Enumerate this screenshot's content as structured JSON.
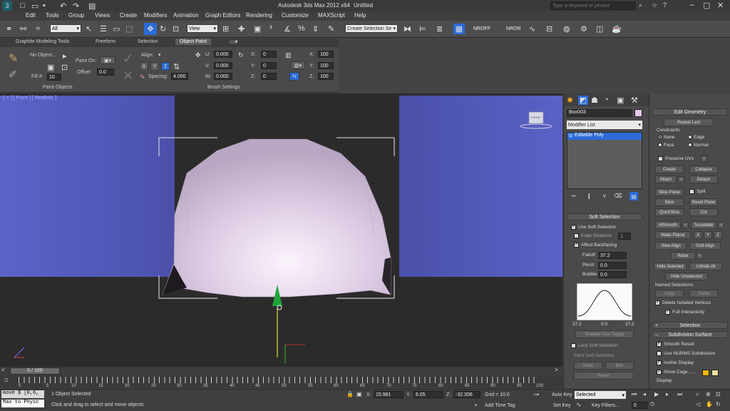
{
  "window": {
    "title": "Autodesk 3ds Max  2012 x64",
    "doc": "Untitled",
    "search_placeholder": "Type a keyword or phrase"
  },
  "menu": [
    "Edit",
    "Tools",
    "Group",
    "Views",
    "Create",
    "Modifiers",
    "Animation",
    "Graph Editors",
    "Rendering",
    "Customize",
    "MAXScript",
    "Help"
  ],
  "toolbar": {
    "filter": "All",
    "refcoord": "View",
    "selection_set": "Create Selection Se",
    "nroff": "NROFF",
    "nron": "NRON"
  },
  "ribbon": {
    "tabs": [
      "Graphite Modeling Tools",
      "Freeform",
      "Selection",
      "Object Paint"
    ],
    "no_object": "No Object...",
    "paint_on": "Paint On:",
    "fill_label": "Fill #:",
    "fill_value": "10",
    "offset_label": "Offset:",
    "offset_value": "0.0",
    "align_label": "Align:",
    "spacing_label": "Spacing:",
    "spacing_value": "4.000",
    "u": "0.000",
    "v": "0.000",
    "w": "0.000",
    "rx": "0",
    "ry": "0",
    "rz": "0",
    "sx": "100",
    "sy": "100",
    "sz": "100",
    "group1": "Paint Objects",
    "group2": "Brush Settings"
  },
  "viewport": {
    "label": "[ + ] [ Front ] [ Realistic ]",
    "viewcube": "FRONT"
  },
  "command_panel": {
    "object_name": "Box003",
    "modifier_list": "Modifier List",
    "stack_item": "Editable Poly",
    "soft_selection": {
      "title": "Soft Selection",
      "use_soft": "Use Soft Selection",
      "edge_distance": "Edge Distance:",
      "edge_val": "1",
      "affect_backfacing": "Affect Backfacing",
      "falloff": "Falloff:",
      "falloff_val": "37.2",
      "pinch": "Pinch:",
      "pinch_val": "0.0",
      "bubble": "Bubble:",
      "bubble_val": "0.0",
      "curve_labels": [
        "37.2",
        "0.0",
        "37.2"
      ],
      "shaded_face": "Shaded Face Toggle",
      "lock": "Lock Soft Selection",
      "paint_soft": "Paint Soft Selection",
      "paint": "Paint",
      "blur": "Blur",
      "revert": "Revert"
    }
  },
  "rollout": {
    "edit_geometry": "Edit Geometry",
    "repeat_last": "Repeat Last",
    "constraints": "Constraints",
    "none": "None",
    "edge": "Edge",
    "face": "Face",
    "normal": "Normal",
    "preserve_uvs": "Preserve UVs",
    "create": "Create",
    "collapse": "Collapse",
    "attach": "Attach",
    "detach": "Detach",
    "slice_plane": "Slice Plane",
    "split": "Split",
    "slice": "Slice",
    "reset_plane": "Reset Plane",
    "quickslice": "QuickSlice",
    "cut": "Cut",
    "msmooth": "MSmooth",
    "tessellate": "Tessellate",
    "make_planar": "Make Planar",
    "x": "X",
    "y": "Y",
    "z": "Z",
    "view_align": "View Align",
    "grid_align": "Grid Align",
    "relax": "Relax",
    "hide_selected": "Hide Selected",
    "unhide_all": "Unhide All",
    "hide_unselected": "Hide Unselected",
    "named_selections": "Named Selections:",
    "copy": "Copy",
    "paste": "Paste",
    "delete_isolated": "Delete Isolated Vertices",
    "full_interactivity": "Full Interactivity",
    "selection": "Selection",
    "subdivision_surface": "Subdivision Surface",
    "smooth_result": "Smooth Result",
    "use_nurms": "Use NURMS Subdivision",
    "isoline": "Isoline Display",
    "show_cage": "Show Cage......",
    "display": "Display"
  },
  "timeline": {
    "frame": "0 / 100",
    "ticks": [
      "0",
      "5",
      "10",
      "15",
      "20",
      "25",
      "30",
      "35",
      "40",
      "45",
      "50",
      "55",
      "60",
      "65",
      "70",
      "75",
      "80",
      "85",
      "90",
      "95",
      "100"
    ]
  },
  "status": {
    "script1": "move $ [0,6,",
    "script2": "Max to Physc",
    "selected": "1 Object Selected",
    "prompt": "Click and drag to select and move objects",
    "x_label": "X:",
    "x": "15.981",
    "y_label": "Y:",
    "y": "6.05",
    "z_label": "Z:",
    "z": "-32.356",
    "grid": "Grid = 10.0",
    "add_time_tag": "Add Time Tag",
    "auto_key": "Auto Key",
    "set_key": "Set Key",
    "selected_dd": "Selected",
    "key_filters": "Key Filters...",
    "frame_val": "0"
  },
  "colors": {
    "wall": "#5b63c8",
    "mesh": "#e6d8ea",
    "accent": "#2a6bd8"
  }
}
